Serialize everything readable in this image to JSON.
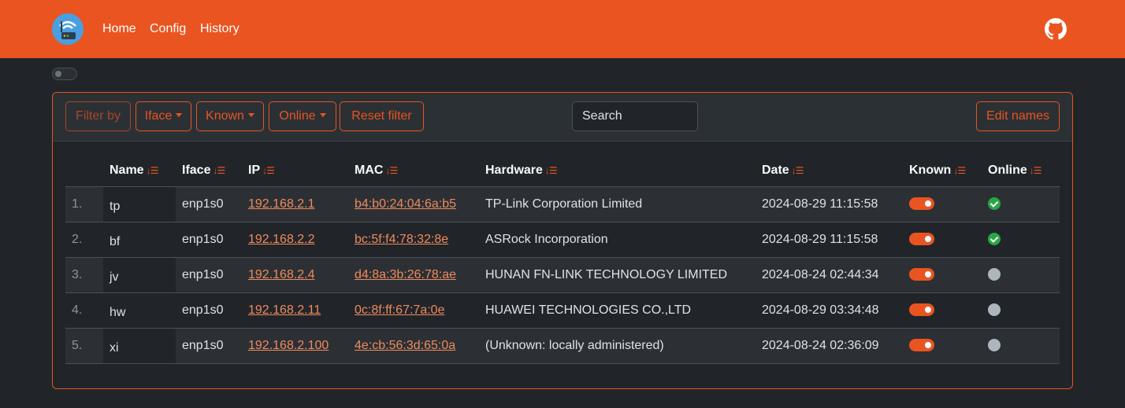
{
  "nav": {
    "items": [
      "Home",
      "Config",
      "History"
    ]
  },
  "toolbar": {
    "filter_by": "Filter by",
    "iface": "Iface",
    "known": "Known",
    "online": "Online",
    "reset": "Reset filter",
    "search_placeholder": "Search",
    "edit_names": "Edit names"
  },
  "table": {
    "columns": [
      "Name",
      "Iface",
      "IP",
      "MAC",
      "Hardware",
      "Date",
      "Known",
      "Online"
    ],
    "rows": [
      {
        "idx": "1.",
        "name": "tp",
        "iface": "enp1s0",
        "ip": "192.168.2.1",
        "mac": "b4:b0:24:04:6a:b5",
        "hw": "TP-Link Corporation Limited",
        "date": "2024-08-29 11:15:58",
        "known": true,
        "online": true
      },
      {
        "idx": "2.",
        "name": "bf",
        "iface": "enp1s0",
        "ip": "192.168.2.2",
        "mac": "bc:5f:f4:78:32:8e",
        "hw": "ASRock Incorporation",
        "date": "2024-08-29 11:15:58",
        "known": true,
        "online": true
      },
      {
        "idx": "3.",
        "name": "jv",
        "iface": "enp1s0",
        "ip": "192.168.2.4",
        "mac": "d4:8a:3b:26:78:ae",
        "hw": "HUNAN FN-LINK TECHNOLOGY LIMITED",
        "date": "2024-08-24 02:44:34",
        "known": true,
        "online": false
      },
      {
        "idx": "4.",
        "name": "hw",
        "iface": "enp1s0",
        "ip": "192.168.2.11",
        "mac": "0c:8f:ff:67:7a:0e",
        "hw": "HUAWEI TECHNOLOGIES CO.,LTD",
        "date": "2024-08-29 03:34:48",
        "known": true,
        "online": false
      },
      {
        "idx": "5.",
        "name": "xi",
        "iface": "enp1s0",
        "ip": "192.168.2.100",
        "mac": "4e:cb:56:3d:65:0a",
        "hw": "(Unknown: locally administered)",
        "date": "2024-08-24 02:36:09",
        "known": true,
        "online": false
      }
    ]
  },
  "colors": {
    "accent": "#e95420",
    "background": "#212529",
    "online": "#28a745",
    "offline": "#adb5bd"
  }
}
